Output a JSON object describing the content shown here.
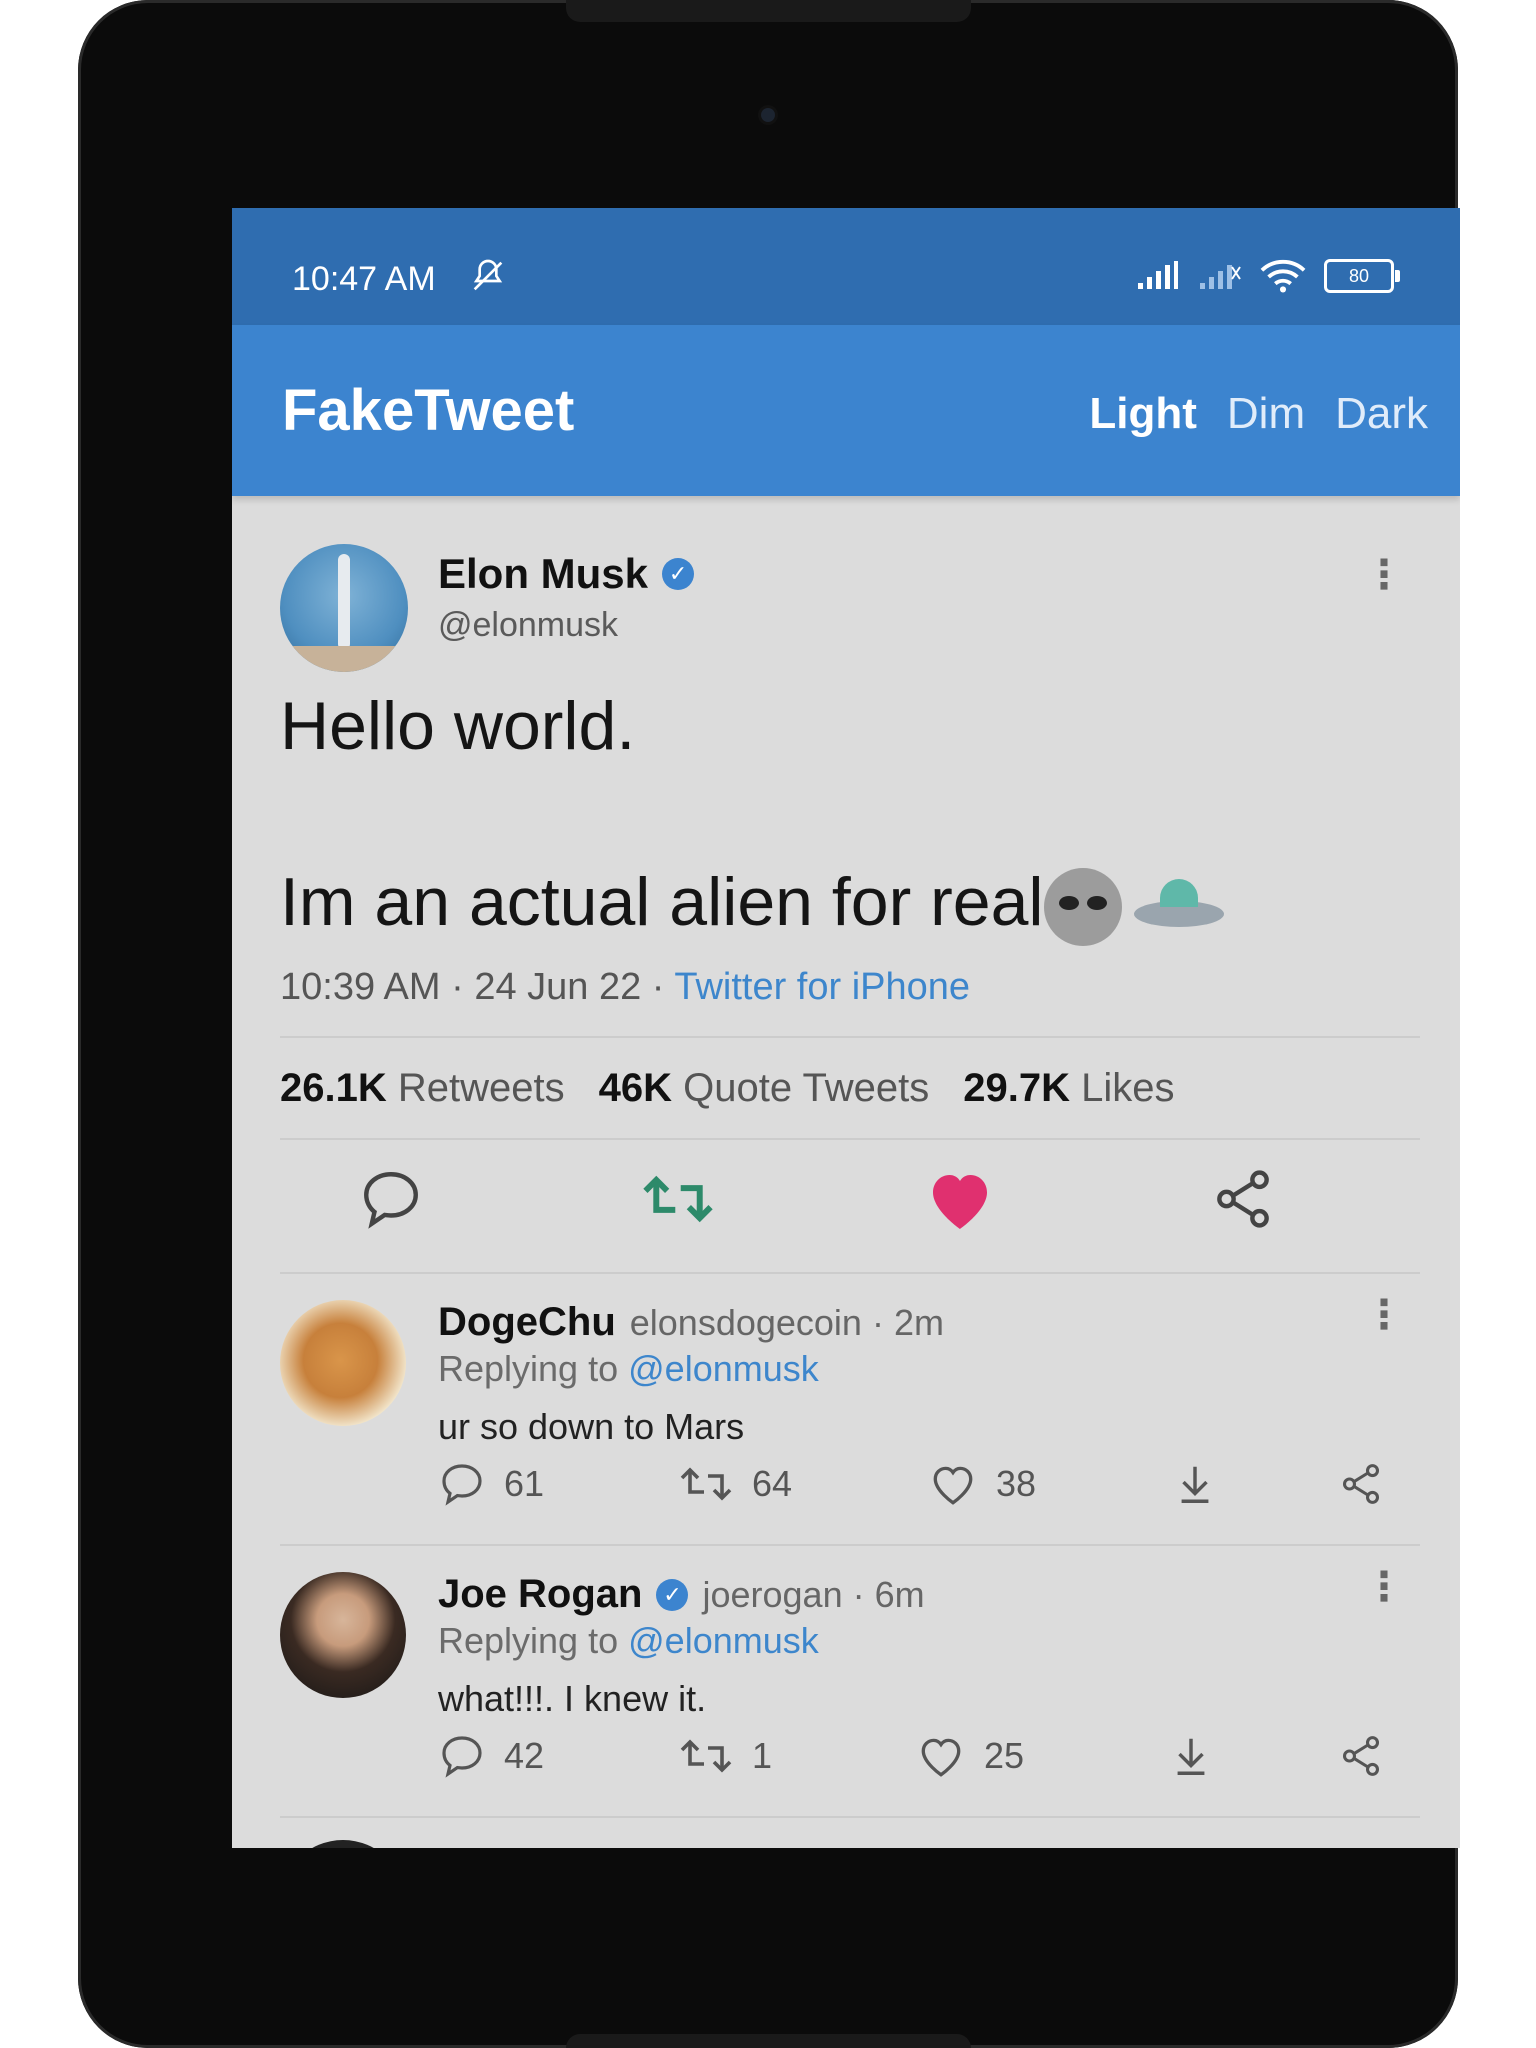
{
  "status_bar": {
    "time": "10:47 AM",
    "battery": "80",
    "icons": [
      "mute-icon",
      "signal-icon",
      "signal-icon-2",
      "wifi-icon",
      "battery-icon"
    ]
  },
  "app_bar": {
    "title": "FakeTweet",
    "themes": [
      "Light",
      "Dim",
      "Dark"
    ],
    "selected_theme": "Light"
  },
  "tweet": {
    "author_name": "Elon Musk",
    "author_handle": "@elonmusk",
    "line1": "Hello world.",
    "line2": "Im an actual alien for real",
    "emojis": [
      "alien",
      "ufo"
    ],
    "timestamp": "10:39 AM · 24 Jun 22 ·",
    "source": "Twitter for iPhone",
    "stats": {
      "retweets_count": "26.1K",
      "retweets_label": "Retweets",
      "quotes_count": "46K",
      "quotes_label": "Quote Tweets",
      "likes_count": "29.7K",
      "likes_label": "Likes"
    },
    "liked": true
  },
  "replies": [
    {
      "name": "DogeChu",
      "meta": "elonsdogecoin · 2m",
      "verified": false,
      "replying_prefix": "Replying to",
      "replying_handle": "@elonmusk",
      "text": "ur so down to Mars",
      "replies": "61",
      "retweets": "64",
      "likes": "38"
    },
    {
      "name": "Joe Rogan",
      "meta": "joerogan · 6m",
      "verified": true,
      "replying_prefix": "Replying to",
      "replying_handle": "@elonmusk",
      "text": "what!!!. I knew it.",
      "replies": "42",
      "retweets": "1",
      "likes": "25"
    }
  ],
  "colors": {
    "status_bar": "#2f6db0",
    "app_bar": "#3c84cf",
    "background": "#dcdcdc",
    "link": "#3d86cc",
    "retweet": "#2d8a6a",
    "like": "#e0306f"
  }
}
